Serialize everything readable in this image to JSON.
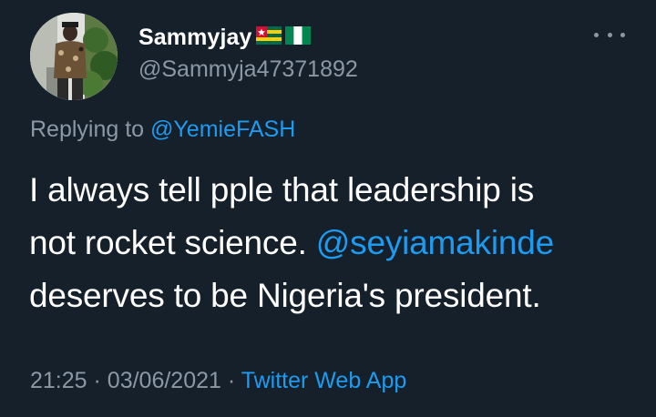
{
  "author": {
    "display_name": "Sammyjay",
    "handle": "@Sammyja47371892",
    "flags": [
      "togo-flag-emoji",
      "nigeria-flag-emoji"
    ]
  },
  "reply": {
    "prefix": "Replying to",
    "mention": "@YemieFASH"
  },
  "tweet": {
    "line1": "I always tell pple that leadership is",
    "line2_text": "not rocket science.",
    "line2_mention": "@seyiamakinde",
    "line3": "deserves to be Nigeria's president."
  },
  "meta": {
    "time": "21:25",
    "separator": "·",
    "date": "03/06/2021",
    "source": "Twitter Web App"
  },
  "colors": {
    "background": "#15202b",
    "text": "#ffffff",
    "muted": "#8b98a5",
    "link": "#1d9bf0"
  },
  "icons": {
    "more": "more-horizontal-icon"
  }
}
